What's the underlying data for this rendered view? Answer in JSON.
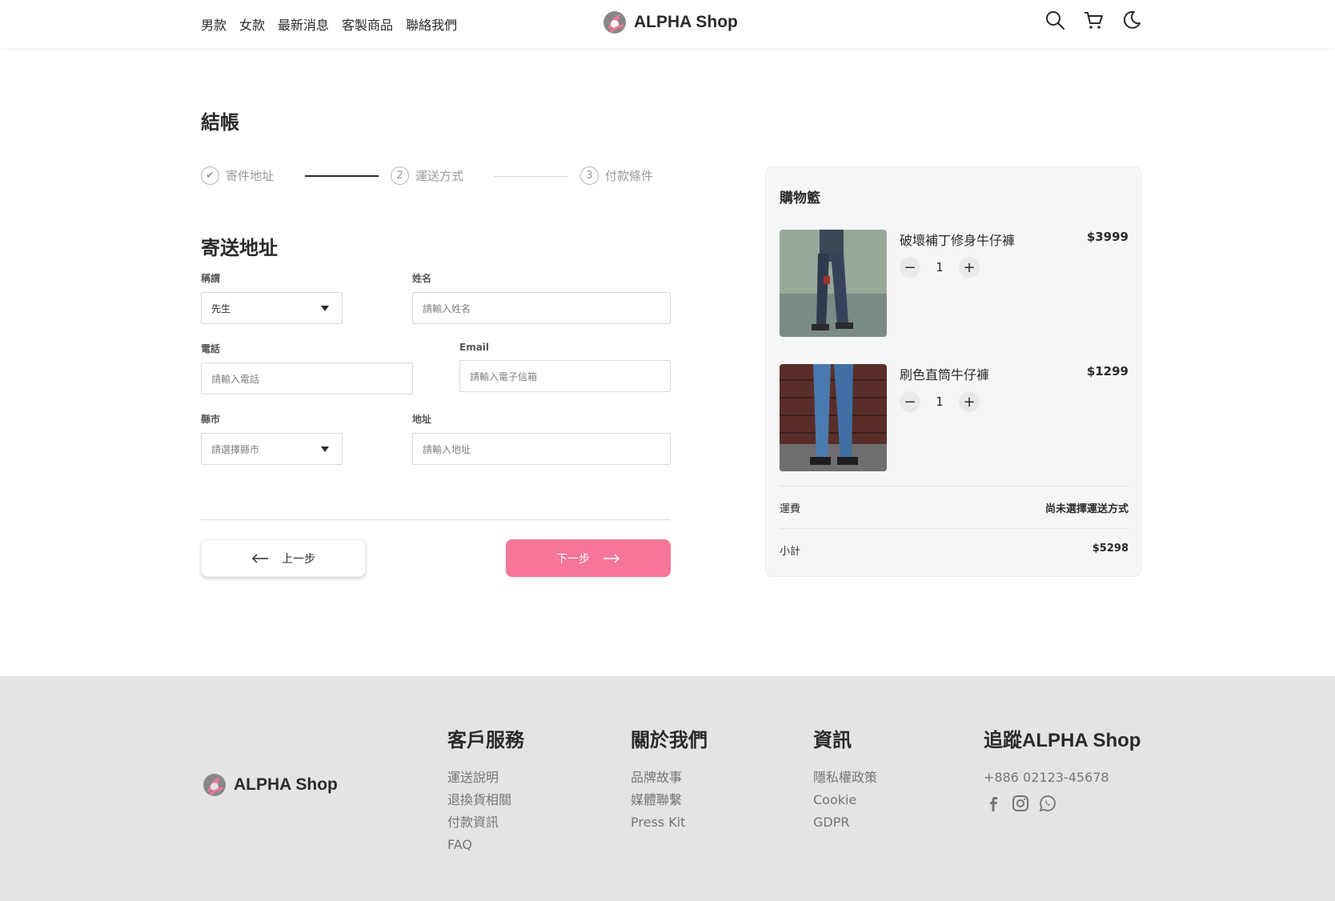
{
  "brand": {
    "name": "ALPHA Shop",
    "accent": "#f67599",
    "logo_gray": "#888888"
  },
  "nav": {
    "items": [
      "男款",
      "女款",
      "最新消息",
      "客製商品",
      "聯絡我們"
    ]
  },
  "header_icons": [
    "search-icon",
    "cart-icon",
    "moon-icon"
  ],
  "page": {
    "title": "結帳"
  },
  "stepper": {
    "steps": [
      {
        "label": "寄件地址",
        "marker": "✔"
      },
      {
        "label": "運送方式",
        "marker": "2"
      },
      {
        "label": "付款條件",
        "marker": "3"
      }
    ]
  },
  "form": {
    "section_title": "寄送地址",
    "salutation": {
      "label": "稱謂",
      "value": "先生"
    },
    "name": {
      "label": "姓名",
      "placeholder": "請輸入姓名"
    },
    "phone": {
      "label": "電話",
      "placeholder": "請輸入電話"
    },
    "email": {
      "label": "Email",
      "placeholder": "請輸入電子信箱"
    },
    "city": {
      "label": "縣市",
      "placeholder": "請選擇縣市"
    },
    "address": {
      "label": "地址",
      "placeholder": "請輸入地址"
    }
  },
  "buttons": {
    "prev": "上一步",
    "next": "下一步"
  },
  "cart": {
    "title": "購物籃",
    "items": [
      {
        "name": "破壞補丁修身牛仔褲",
        "price": "$3999",
        "qty": "1"
      },
      {
        "name": "刷色直筒牛仔褲",
        "price": "$1299",
        "qty": "1"
      }
    ],
    "shipping_label": "運費",
    "shipping_value": "尚未選擇運送方式",
    "subtotal_label": "小計",
    "subtotal_value": "$5298"
  },
  "footer": {
    "columns": [
      {
        "title": "客戶服務",
        "links": [
          "運送說明",
          "退換貨相關",
          "付款資訊",
          "FAQ"
        ]
      },
      {
        "title": "關於我們",
        "links": [
          "品牌故事",
          "媒體聯繫",
          "Press Kit"
        ]
      },
      {
        "title": "資訊",
        "links": [
          "隱私權政策",
          "Cookie",
          "GDPR"
        ]
      },
      {
        "title": "追蹤ALPHA Shop",
        "links": [
          "+886 02123-45678"
        ]
      }
    ],
    "social_icons": [
      "facebook-icon",
      "instagram-icon",
      "whatsapp-icon"
    ]
  }
}
